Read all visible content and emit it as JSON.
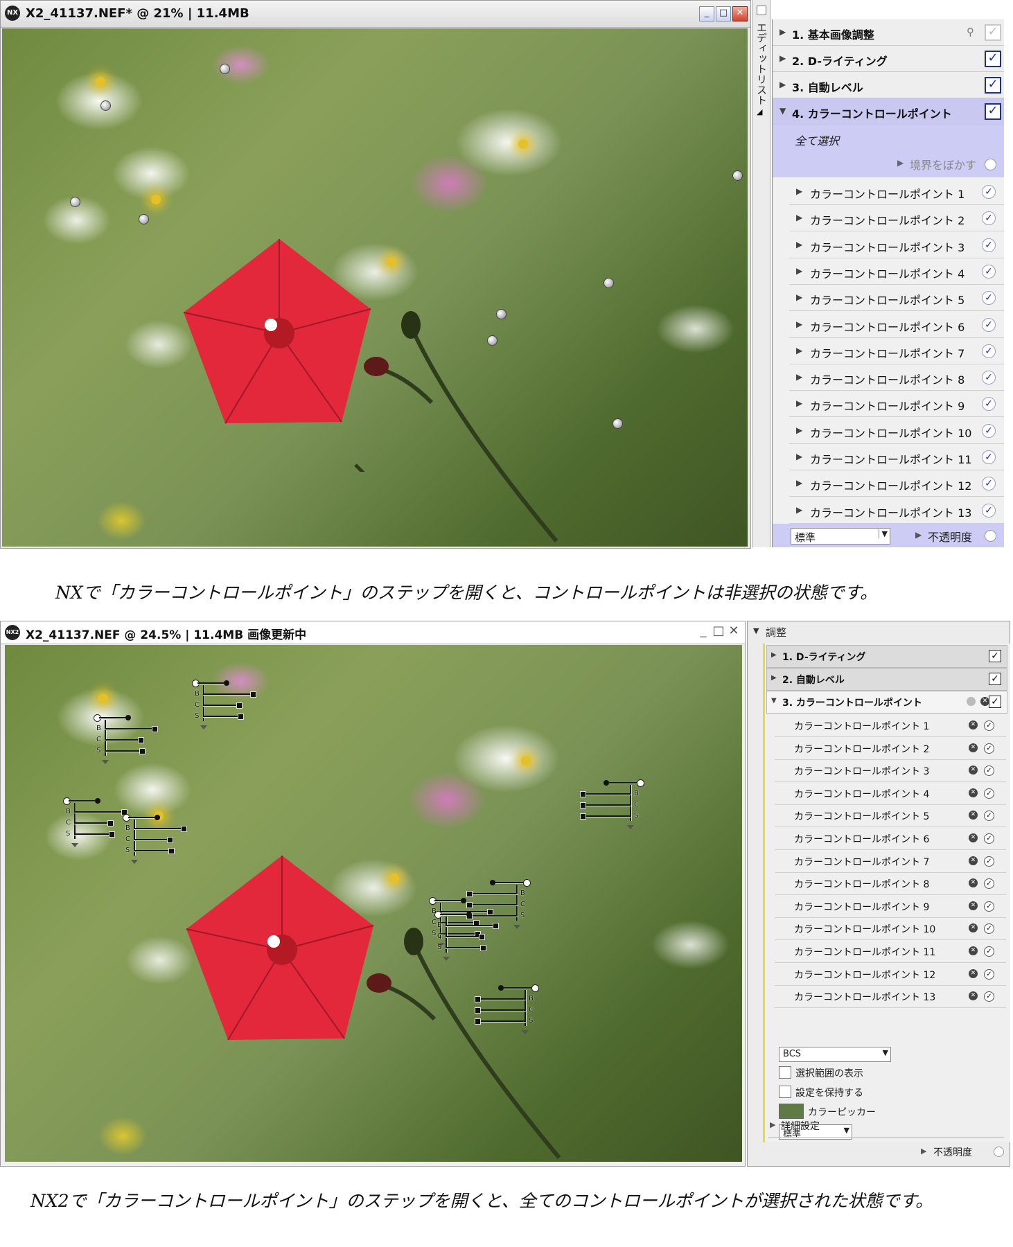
{
  "nx1": {
    "window": {
      "title": "X2_41137.NEF* @ 21% | 11.4MB"
    },
    "side_strip_label": "エディットリスト",
    "steps": [
      {
        "label": "1. 基本画像調整",
        "checked": false
      },
      {
        "label": "2. D-ライティング",
        "checked": true
      },
      {
        "label": "3. 自動レベル",
        "checked": true
      },
      {
        "label": "4. カラーコントロールポイント",
        "checked": true
      }
    ],
    "select_all": "全て選択",
    "feather": "境界をぼかす",
    "control_points": [
      "カラーコントロールポイント 1",
      "カラーコントロールポイント 2",
      "カラーコントロールポイント 3",
      "カラーコントロールポイント 4",
      "カラーコントロールポイント 5",
      "カラーコントロールポイント 6",
      "カラーコントロールポイント 7",
      "カラーコントロールポイント 8",
      "カラーコントロールポイント 9",
      "カラーコントロールポイント 10",
      "カラーコントロールポイント 11",
      "カラーコントロールポイント 12",
      "カラーコントロールポイント 13"
    ],
    "blend_mode": "標準",
    "opacity": "不透明度"
  },
  "caption1": "NXで「カラーコントロールポイント」のステップを開くと、コントロールポイントは非選択の状態です。",
  "nx2": {
    "window": {
      "title": "X2_41137.NEF  @  24.5%  |  11.4MB 画像更新中",
      "logo": "NX2"
    },
    "section_header": "調整",
    "steps": [
      {
        "label": "1. D-ライティング"
      },
      {
        "label": "2. 自動レベル"
      },
      {
        "label": "3. カラーコントロールポイント"
      }
    ],
    "control_points": [
      "カラーコントロールポイント 1",
      "カラーコントロールポイント 2",
      "カラーコントロールポイント 3",
      "カラーコントロールポイント 4",
      "カラーコントロールポイント 5",
      "カラーコントロールポイント 6",
      "カラーコントロールポイント 7",
      "カラーコントロールポイント 8",
      "カラーコントロールポイント 9",
      "カラーコントロールポイント 10",
      "カラーコントロールポイント 11",
      "カラーコントロールポイント 12",
      "カラーコントロールポイント 13"
    ],
    "mode_select": "BCS",
    "show_selection": "選択範囲の表示",
    "keep_settings": "設定を保持する",
    "color_picker": "カラーピッカー",
    "color_picker_swatch": "#5f7a45",
    "blend_mode": "標準",
    "advanced": "詳細設定",
    "opacity": "不透明度",
    "slider_letters": [
      "B",
      "C",
      "S"
    ]
  },
  "caption2": "NX2で「カラーコントロールポイント」のステップを開くと、全てのコントロールポイントが選択された状態です。"
}
